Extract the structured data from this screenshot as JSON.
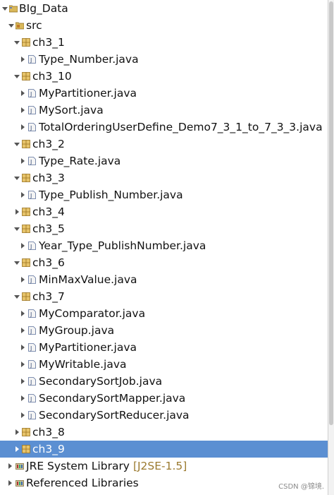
{
  "tree": {
    "project": "BIg_Data",
    "src": "src",
    "ch3_1": {
      "label": "ch3_1",
      "files": [
        "Type_Number.java"
      ]
    },
    "ch3_10": {
      "label": "ch3_10",
      "files": [
        "MyPartitioner.java",
        "MySort.java",
        "TotalOrderingUserDefine_Demo7_3_1_to_7_3_3.java"
      ]
    },
    "ch3_2": {
      "label": "ch3_2",
      "files": [
        "Type_Rate.java"
      ]
    },
    "ch3_3": {
      "label": "ch3_3",
      "files": [
        "Type_Publish_Number.java"
      ]
    },
    "ch3_4": {
      "label": "ch3_4"
    },
    "ch3_5": {
      "label": "ch3_5",
      "files": [
        "Year_Type_PublishNumber.java"
      ]
    },
    "ch3_6": {
      "label": "ch3_6",
      "files": [
        "MinMaxValue.java"
      ]
    },
    "ch3_7": {
      "label": "ch3_7",
      "files": [
        "MyComparator.java",
        "MyGroup.java",
        "MyPartitioner.java",
        "MyWritable.java",
        "SecondarySortJob.java",
        "SecondarySortMapper.java",
        "SecondarySortReducer.java"
      ]
    },
    "ch3_8": {
      "label": "ch3_8"
    },
    "ch3_9": {
      "label": "ch3_9"
    },
    "jre": {
      "label": "JRE System Library",
      "suffix": "[J2SE-1.5]"
    },
    "referenced": {
      "label": "Referenced Libraries"
    }
  },
  "watermark": "CSDN @锦境.",
  "colors": {
    "selection": "#5b8fd2",
    "package": "#c8a34a",
    "java_file": "#5a6f9a",
    "suffix": "#9b7a2f"
  },
  "icons": {
    "project": "project-folder-icon",
    "src": "source-folder-icon",
    "package": "package-icon",
    "java": "java-file-icon",
    "library": "library-icon"
  }
}
